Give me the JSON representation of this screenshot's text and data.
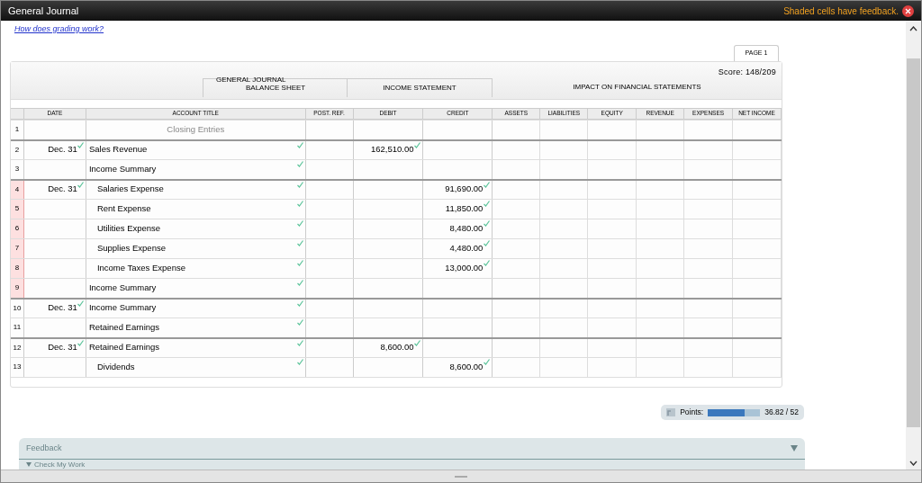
{
  "window": {
    "title": "General Journal",
    "notice": "Shaded cells have feedback."
  },
  "help_link": "How does grading work?",
  "page_tab": {
    "label": "PAGE 1",
    "selected": true
  },
  "score": "Score: 148/209",
  "group_headers": {
    "general_journal": "GENERAL JOURNAL",
    "balance_sheet": "BALANCE SHEET",
    "income_statement": "INCOME STATEMENT",
    "impact": "IMPACT ON FINANCIAL STATEMENTS"
  },
  "columns": [
    "DATE",
    "ACCOUNT TITLE",
    "POST. REF.",
    "DEBIT",
    "CREDIT",
    "ASSETS",
    "LIABILITIES",
    "EQUITY",
    "REVENUE",
    "EXPENSES",
    "NET INCOME"
  ],
  "rows": [
    {
      "number": "1",
      "kind": "heading",
      "entry_start": false,
      "flagged": false,
      "date": "",
      "date_checked": false,
      "title": "Closing Entries",
      "title_checked": false,
      "debit": "",
      "debit_checked": false,
      "credit": "",
      "credit_checked": false
    },
    {
      "number": "2",
      "kind": "debit",
      "entry_start": true,
      "flagged": false,
      "date": "Dec. 31",
      "date_checked": true,
      "title": "Sales Revenue",
      "title_checked": true,
      "debit": "162,510.00",
      "debit_checked": true,
      "credit": "",
      "credit_checked": false
    },
    {
      "number": "3",
      "kind": "debit",
      "entry_start": false,
      "flagged": false,
      "date": "",
      "date_checked": false,
      "title": "Income Summary",
      "title_checked": true,
      "debit": "",
      "debit_checked": false,
      "credit": "",
      "credit_checked": false
    },
    {
      "number": "4",
      "kind": "credit",
      "entry_start": true,
      "flagged": true,
      "date": "Dec. 31",
      "date_checked": true,
      "title": "Salaries Expense",
      "title_checked": true,
      "debit": "",
      "debit_checked": false,
      "credit": "91,690.00",
      "credit_checked": true
    },
    {
      "number": "5",
      "kind": "credit",
      "entry_start": false,
      "flagged": true,
      "date": "",
      "date_checked": false,
      "title": "Rent Expense",
      "title_checked": true,
      "debit": "",
      "debit_checked": false,
      "credit": "11,850.00",
      "credit_checked": true
    },
    {
      "number": "6",
      "kind": "credit",
      "entry_start": false,
      "flagged": true,
      "date": "",
      "date_checked": false,
      "title": "Utilities Expense",
      "title_checked": true,
      "debit": "",
      "debit_checked": false,
      "credit": "8,480.00",
      "credit_checked": true
    },
    {
      "number": "7",
      "kind": "credit",
      "entry_start": false,
      "flagged": true,
      "date": "",
      "date_checked": false,
      "title": "Supplies Expense",
      "title_checked": true,
      "debit": "",
      "debit_checked": false,
      "credit": "4,480.00",
      "credit_checked": true
    },
    {
      "number": "8",
      "kind": "credit",
      "entry_start": false,
      "flagged": true,
      "date": "",
      "date_checked": false,
      "title": "Income Taxes Expense",
      "title_checked": true,
      "debit": "",
      "debit_checked": false,
      "credit": "13,000.00",
      "credit_checked": true
    },
    {
      "number": "9",
      "kind": "debit",
      "entry_start": false,
      "flagged": true,
      "date": "",
      "date_checked": false,
      "title": "Income Summary",
      "title_checked": true,
      "debit": "",
      "debit_checked": false,
      "credit": "",
      "credit_checked": false
    },
    {
      "number": "10",
      "kind": "debit",
      "entry_start": true,
      "flagged": false,
      "date": "Dec. 31",
      "date_checked": true,
      "title": "Income Summary",
      "title_checked": true,
      "debit": "",
      "debit_checked": false,
      "credit": "",
      "credit_checked": false
    },
    {
      "number": "11",
      "kind": "debit",
      "entry_start": false,
      "flagged": false,
      "date": "",
      "date_checked": false,
      "title": "Retained Earnings",
      "title_checked": true,
      "debit": "",
      "debit_checked": false,
      "credit": "",
      "credit_checked": false
    },
    {
      "number": "12",
      "kind": "debit",
      "entry_start": true,
      "flagged": false,
      "date": "Dec. 31",
      "date_checked": true,
      "title": "Retained Earnings",
      "title_checked": true,
      "debit": "8,600.00",
      "debit_checked": true,
      "credit": "",
      "credit_checked": false
    },
    {
      "number": "13",
      "kind": "credit",
      "entry_start": false,
      "flagged": false,
      "date": "",
      "date_checked": false,
      "title": "Dividends",
      "title_checked": true,
      "debit": "",
      "debit_checked": false,
      "credit": "8,600.00",
      "credit_checked": true
    }
  ],
  "points": {
    "label": "Points:",
    "level": 0.708,
    "reading": "36.82 / 52"
  },
  "feedback": {
    "title": "Feedback",
    "expanded": false,
    "check_my_work": "Check My Work"
  }
}
